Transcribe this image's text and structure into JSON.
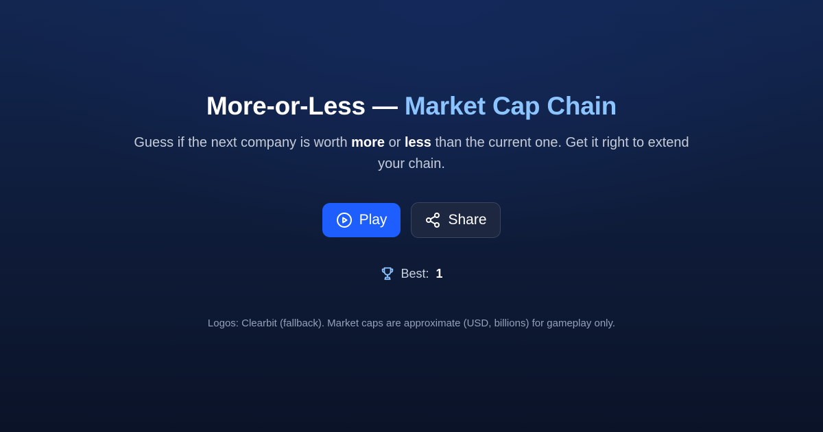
{
  "hero": {
    "title_main": "More-or-Less —",
    "title_accent": "Market Cap Chain",
    "subtitle": {
      "part1": "Guess if the next company is worth ",
      "more": "more",
      "part2": " or ",
      "less": "less",
      "part3": " than the current one. Get it right to extend your chain."
    }
  },
  "actions": {
    "play_label": "Play",
    "play_icon": "play-circle-icon",
    "share_label": "Share",
    "share_icon": "share-icon"
  },
  "best": {
    "icon": "trophy-icon",
    "label": "Best:",
    "value": "1"
  },
  "footnote": "Logos: Clearbit (fallback). Market caps are approximate (USD, billions) for gameplay only.",
  "colors": {
    "accent": "#8cc4ff",
    "primary_button": "#1e5eff",
    "background_top": "#122650",
    "background_bottom": "#0b1328"
  }
}
